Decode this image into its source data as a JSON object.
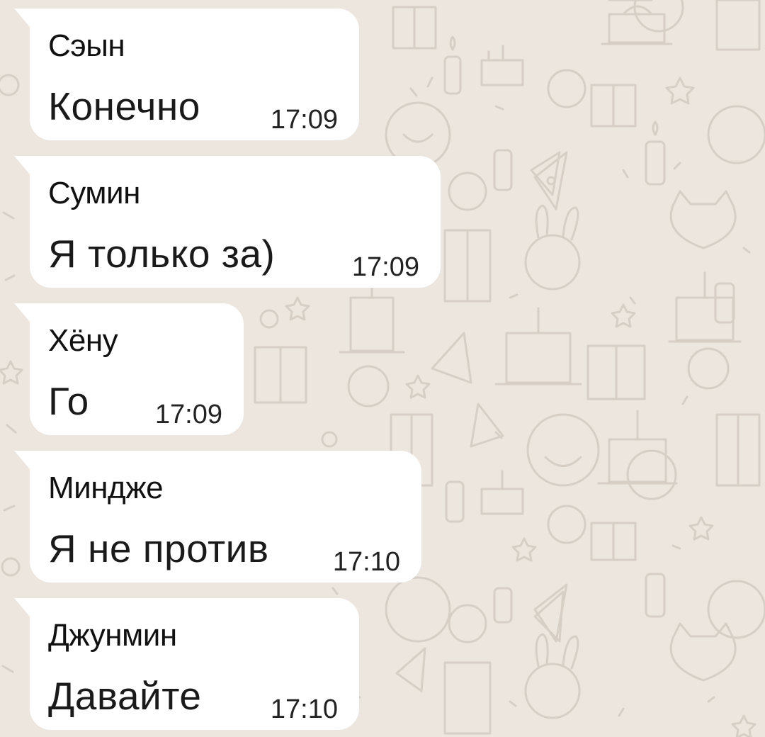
{
  "chat": {
    "messages": [
      {
        "sender": "Сэын",
        "text": "Конечно",
        "time": "17:09"
      },
      {
        "sender": "Сумин",
        "text": "Я только за)",
        "time": "17:09"
      },
      {
        "sender": "Хёну",
        "text": "Го",
        "time": "17:09"
      },
      {
        "sender": "Миндже",
        "text": "Я не против",
        "time": "17:10"
      },
      {
        "sender": "Джунмин",
        "text": "Давайте",
        "time": "17:10"
      }
    ]
  },
  "colors": {
    "background": "#ece6df",
    "bubble": "#ffffff",
    "wallpaper_doodle": "#d6cec5"
  },
  "wallpaper": {
    "icons": [
      "gift-icon",
      "cake-icon",
      "party-hat-icon",
      "candle-icon",
      "confetti-icon",
      "star-icon",
      "face-icon",
      "bunny-icon",
      "cat-icon",
      "pizza-icon"
    ]
  }
}
